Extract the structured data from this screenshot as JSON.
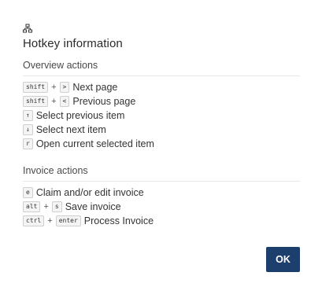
{
  "dialog": {
    "icon": "sitemap-icon",
    "title": "Hotkey information",
    "ok_label": "OK",
    "accent_color": "#1d3f6e"
  },
  "sections": [
    {
      "heading": "Overview actions",
      "items": [
        {
          "keys": [
            "shift",
            ">"
          ],
          "label": "Next page"
        },
        {
          "keys": [
            "shift",
            "<"
          ],
          "label": "Previous page"
        },
        {
          "keys": [
            "↑"
          ],
          "label": "Select previous item"
        },
        {
          "keys": [
            "↓"
          ],
          "label": "Select next item"
        },
        {
          "keys": [
            "r"
          ],
          "label": "Open current selected item"
        }
      ]
    },
    {
      "heading": "Invoice actions",
      "items": [
        {
          "keys": [
            "e"
          ],
          "label": "Claim and/or edit invoice"
        },
        {
          "keys": [
            "alt",
            "s"
          ],
          "label": "Save invoice"
        },
        {
          "keys": [
            "ctrl",
            "enter"
          ],
          "label": "Process Invoice"
        }
      ]
    }
  ],
  "key_separator": "+"
}
